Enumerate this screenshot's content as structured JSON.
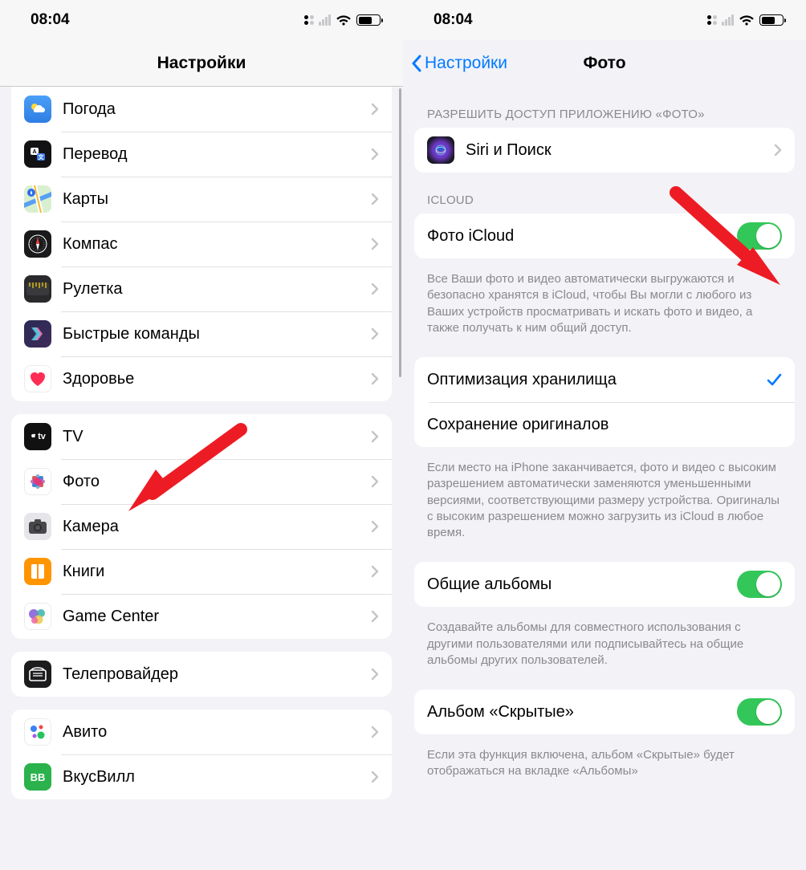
{
  "statusbar": {
    "time": "08:04"
  },
  "left": {
    "title": "Настройки",
    "group1": [
      {
        "name": "weather",
        "label": "Погода"
      },
      {
        "name": "translate",
        "label": "Перевод"
      },
      {
        "name": "maps",
        "label": "Карты"
      },
      {
        "name": "compass",
        "label": "Компас"
      },
      {
        "name": "measure",
        "label": "Рулетка"
      },
      {
        "name": "shortcuts",
        "label": "Быстрые команды"
      },
      {
        "name": "health",
        "label": "Здоровье"
      }
    ],
    "group2": [
      {
        "name": "tv",
        "label": "TV"
      },
      {
        "name": "photos",
        "label": "Фото"
      },
      {
        "name": "camera",
        "label": "Камера"
      },
      {
        "name": "books",
        "label": "Книги"
      },
      {
        "name": "gamecenter",
        "label": "Game Center"
      }
    ],
    "group3": [
      {
        "name": "teleprovider",
        "label": "Телепровайдер"
      }
    ],
    "group4": [
      {
        "name": "avito",
        "label": "Авито"
      },
      {
        "name": "vkusvill",
        "label": "ВкусВилл"
      }
    ]
  },
  "right": {
    "back": "Настройки",
    "title": "Фото",
    "section_access": "РАЗРЕШИТЬ ДОСТУП ПРИЛОЖЕНИЮ «ФОТО»",
    "siri": "Siri и Поиск",
    "icloud_header": "ICLOUD",
    "icloud_toggle_label": "Фото iCloud",
    "icloud_footer": "Все Ваши фото и видео автоматически выгружаются и безопасно хранятся в iCloud, чтобы Вы могли с любого из Ваших устройств просматривать и искать фото и видео, а также получать к ним общий доступ.",
    "optimize": "Оптимизация хранилища",
    "originals": "Сохранение оригиналов",
    "storage_footer": "Если место на iPhone заканчивается, фото и видео с высоким разрешением автоматически заменяются уменьшенными версиями, соответствующими размеру устройства. Оригиналы с высоким разрешением можно загрузить из iCloud в любое время.",
    "shared_albums": "Общие альбомы",
    "shared_footer": "Создавайте альбомы для совместного использования с другими пользователями или подписывайтесь на общие альбомы других пользователей.",
    "hidden_album": "Альбом «Скрытые»",
    "hidden_footer": "Если эта функция включена, альбом «Скрытые» будет отображаться на вкладке «Альбомы»"
  }
}
